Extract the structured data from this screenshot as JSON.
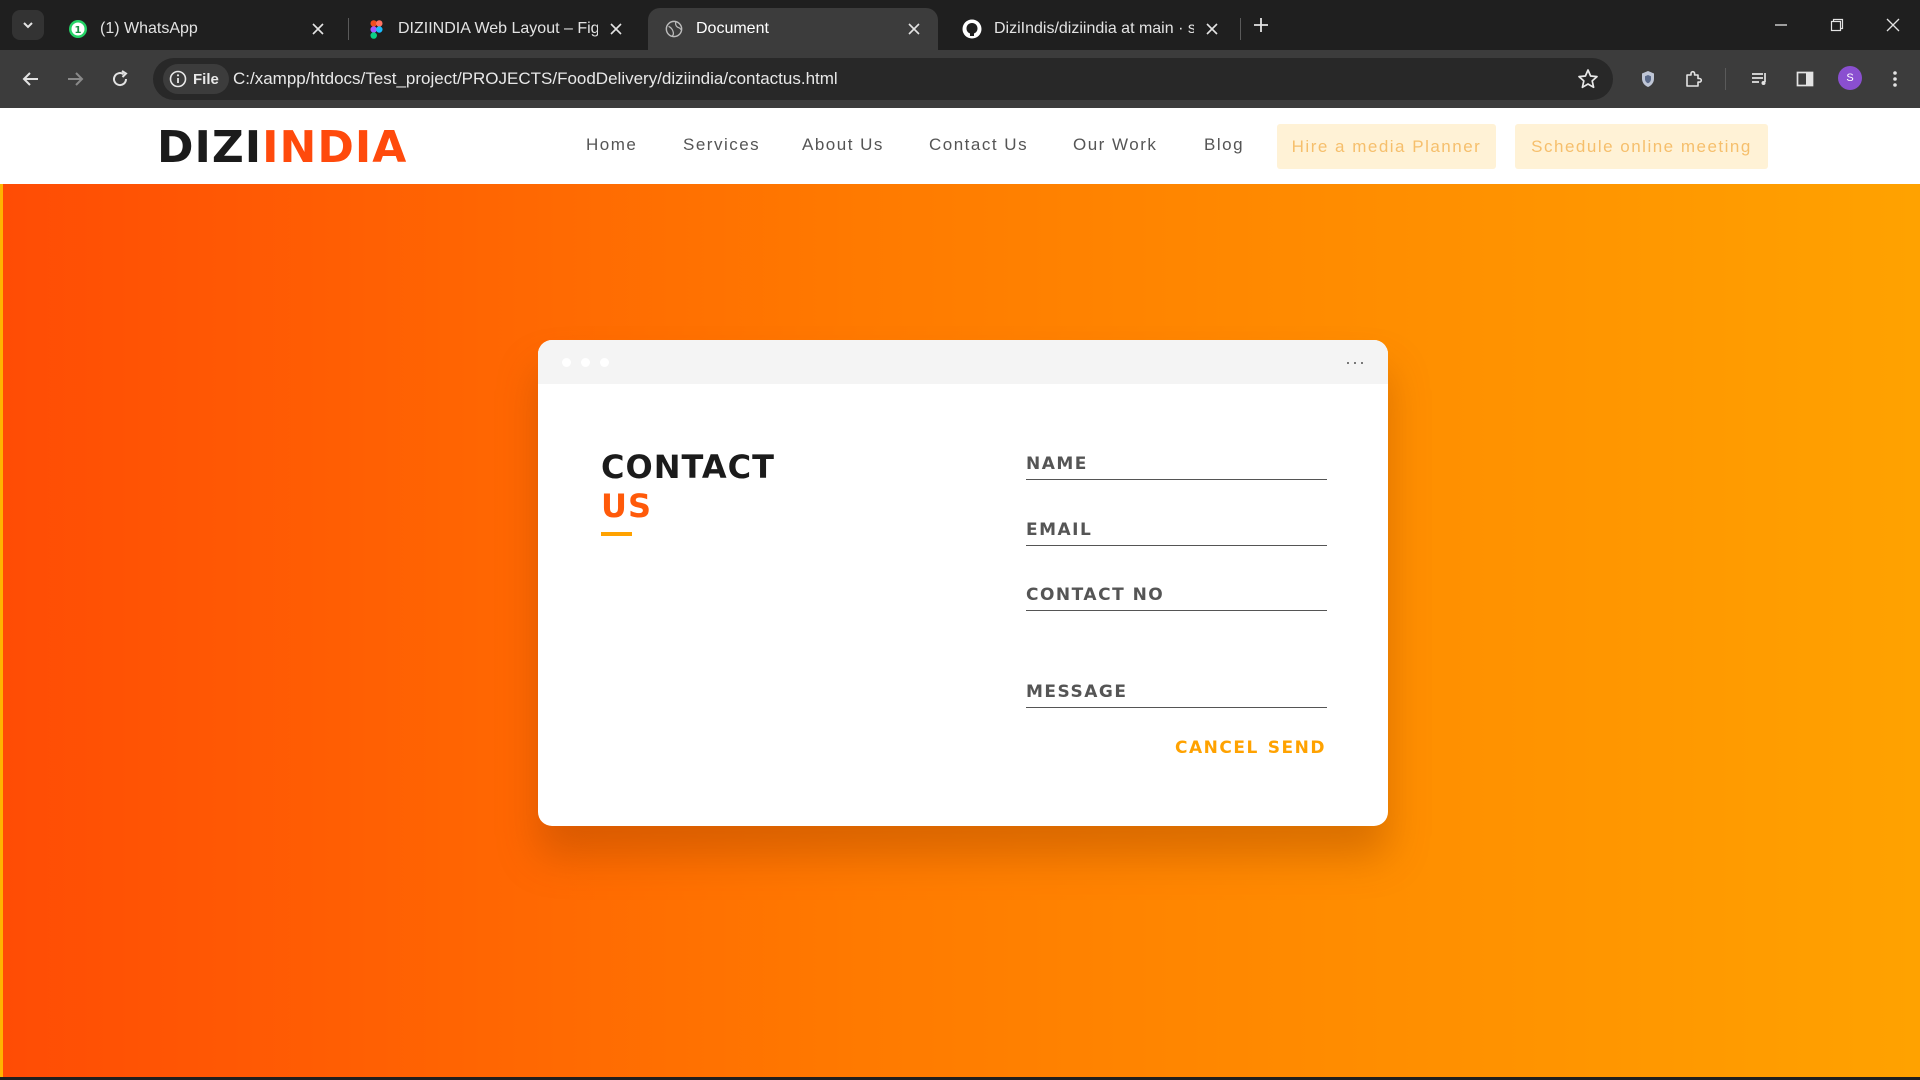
{
  "browser": {
    "tabs": [
      {
        "title": "(1) WhatsApp",
        "favicon": "whatsapp-icon",
        "badge": "1"
      },
      {
        "title": "DIZIINDIA Web Layout – Figma",
        "favicon": "figma-icon"
      },
      {
        "title": "Document",
        "favicon": "globe-icon",
        "active": true
      },
      {
        "title": "DiziIndis/diziindia at main · sha",
        "favicon": "github-icon"
      }
    ],
    "omnibox": {
      "scheme_label": "File",
      "url": "C:/xampp/htdocs/Test_project/PROJECTS/FoodDelivery/diziindia/contactus.html"
    },
    "profile_initial": "S",
    "colors": {
      "tabbar": "#1f1f1f",
      "toolbar": "#3c3c3c",
      "profile": "#8a4fd0"
    }
  },
  "site": {
    "logo": {
      "part1": "DIZI",
      "part2": "INDIA"
    },
    "nav": [
      "Home",
      "Services",
      "About Us",
      "Contact Us",
      "Our Work",
      "Blog"
    ],
    "cta": {
      "planner": "Hire a media Planner",
      "meeting": "Schedule online meeting"
    },
    "colors": {
      "brand_orange": "#ff4a0c",
      "accent_amber": "#ffa200",
      "cta_bg": "#fff2d6",
      "cta_text": "#f6bf6c"
    }
  },
  "contact_card": {
    "more_label": "···",
    "heading": {
      "line1": "CONTACT",
      "line2": "US"
    },
    "fields": {
      "name": "NAME",
      "email": "EMAIL",
      "contact_no": "CONTACT NO",
      "message": "MESSAGE"
    },
    "buttons": {
      "cancel": "CANCEL",
      "send": "SEND"
    }
  }
}
